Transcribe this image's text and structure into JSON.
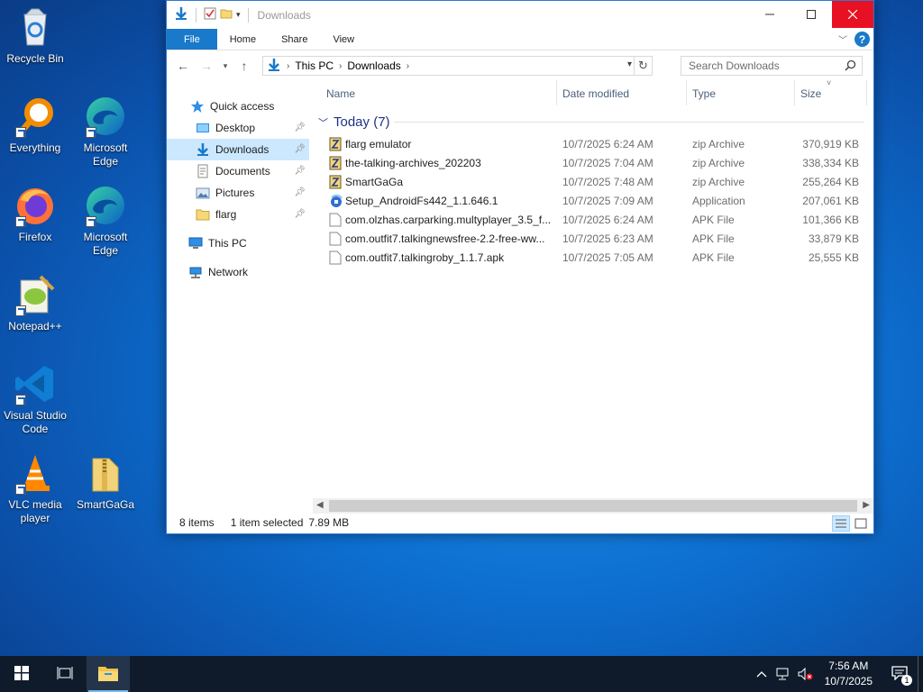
{
  "desktop": {
    "icons": [
      {
        "label": "Recycle Bin",
        "icon": "recycle-bin-icon"
      },
      {
        "label": "Everything",
        "icon": "everything-search-icon"
      },
      {
        "label": "Microsoft Edge",
        "icon": "edge-icon"
      },
      {
        "label": "Firefox",
        "icon": "firefox-icon"
      },
      {
        "label": "Microsoft Edge",
        "icon": "edge-icon"
      },
      {
        "label": "Notepad++",
        "icon": "notepadpp-icon"
      },
      {
        "label": "Visual Studio Code",
        "icon": "vscode-icon"
      },
      {
        "label": "VLC media player",
        "icon": "vlc-icon"
      },
      {
        "label": "SmartGaGa",
        "icon": "zip-folder-icon"
      }
    ]
  },
  "window": {
    "title": "Downloads",
    "ribbon_tabs": [
      "File",
      "Home",
      "Share",
      "View"
    ],
    "address": {
      "crumbs": [
        "This PC",
        "Downloads"
      ]
    },
    "search": {
      "placeholder": "Search Downloads"
    },
    "nav": {
      "quick_access": "Quick access",
      "items": [
        {
          "label": "Desktop",
          "icon": "desktop-folder-icon",
          "pinned": true
        },
        {
          "label": "Downloads",
          "icon": "download-arrow-icon",
          "pinned": true,
          "selected": true
        },
        {
          "label": "Documents",
          "icon": "documents-icon",
          "pinned": true
        },
        {
          "label": "Pictures",
          "icon": "pictures-icon",
          "pinned": true
        },
        {
          "label": "flarg",
          "icon": "folder-icon",
          "pinned": true
        }
      ],
      "this_pc": "This PC",
      "network": "Network"
    },
    "columns": {
      "name": "Name",
      "date": "Date modified",
      "type": "Type",
      "size": "Size"
    },
    "group": {
      "label": "Today (7)"
    },
    "files": [
      {
        "name": "flarg emulator",
        "date": "10/7/2025 6:24 AM",
        "type": "zip Archive",
        "size": "370,919 KB",
        "icon": "zip-icon"
      },
      {
        "name": "the-talking-archives_202203",
        "date": "10/7/2025 7:04 AM",
        "type": "zip Archive",
        "size": "338,334 KB",
        "icon": "zip-icon"
      },
      {
        "name": "SmartGaGa",
        "date": "10/7/2025 7:48 AM",
        "type": "zip Archive",
        "size": "255,264 KB",
        "icon": "zip-icon"
      },
      {
        "name": "Setup_AndroidFs442_1.1.646.1",
        "date": "10/7/2025 7:09 AM",
        "type": "Application",
        "size": "207,061 KB",
        "icon": "installer-icon"
      },
      {
        "name": "com.olzhas.carparking.multyplayer_3.5_f...",
        "date": "10/7/2025 6:24 AM",
        "type": "APK File",
        "size": "101,366 KB",
        "icon": "file-icon"
      },
      {
        "name": "com.outfit7.talkingnewsfree-2.2-free-ww...",
        "date": "10/7/2025 6:23 AM",
        "type": "APK File",
        "size": "33,879 KB",
        "icon": "file-icon"
      },
      {
        "name": "com.outfit7.talkingroby_1.1.7.apk",
        "date": "10/7/2025 7:05 AM",
        "type": "APK File",
        "size": "25,555 KB",
        "icon": "file-icon"
      }
    ],
    "status": {
      "count": "8 items",
      "selected": "1 item selected",
      "size": "7.89 MB"
    }
  },
  "taskbar": {
    "clock_time": "7:56 AM",
    "clock_date": "10/7/2025",
    "notifications_count": "1"
  },
  "colors": {
    "accent": "#1979ca",
    "close": "#e81123",
    "selection": "#cce8ff"
  }
}
